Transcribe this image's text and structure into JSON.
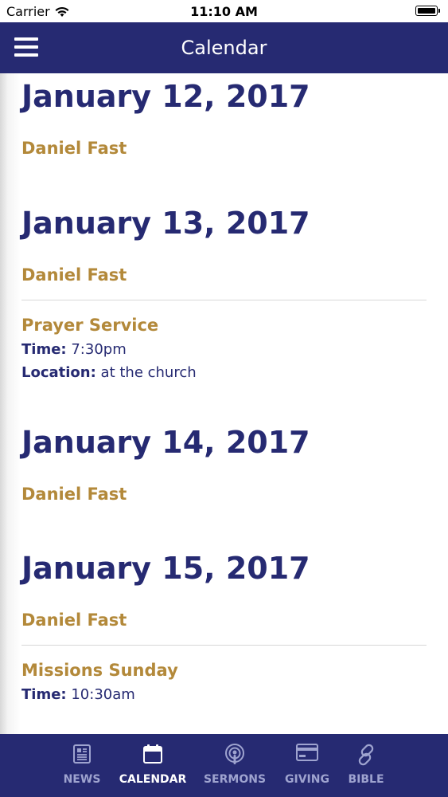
{
  "status_bar": {
    "carrier": "Carrier",
    "time": "11:10 AM"
  },
  "nav": {
    "title": "Calendar"
  },
  "days": [
    {
      "date": "January 12, 2017",
      "events": [
        {
          "title": "Daniel Fast"
        }
      ]
    },
    {
      "date": "January 13, 2017",
      "events": [
        {
          "title": "Daniel Fast"
        },
        {
          "title": "Prayer Service",
          "time_label": "Time:",
          "time": "7:30pm",
          "location_label": "Location:",
          "location": "at the church"
        }
      ]
    },
    {
      "date": "January 14, 2017",
      "events": [
        {
          "title": "Daniel Fast"
        }
      ]
    },
    {
      "date": "January 15, 2017",
      "events": [
        {
          "title": "Daniel Fast"
        },
        {
          "title": "Missions Sunday",
          "time_label": "Time:",
          "time": "10:30am"
        }
      ]
    }
  ],
  "tabs": [
    {
      "label": "NEWS",
      "icon": "newspaper-icon",
      "active": false
    },
    {
      "label": "CALENDAR",
      "icon": "calendar-icon",
      "active": true
    },
    {
      "label": "SERMONS",
      "icon": "podcast-icon",
      "active": false
    },
    {
      "label": "GIVING",
      "icon": "credit-card-icon",
      "active": false
    },
    {
      "label": "BIBLE",
      "icon": "link-icon",
      "active": false
    }
  ],
  "colors": {
    "primary": "#262a72",
    "accent": "#b3893a",
    "tab_inactive": "#9ea3cf"
  }
}
